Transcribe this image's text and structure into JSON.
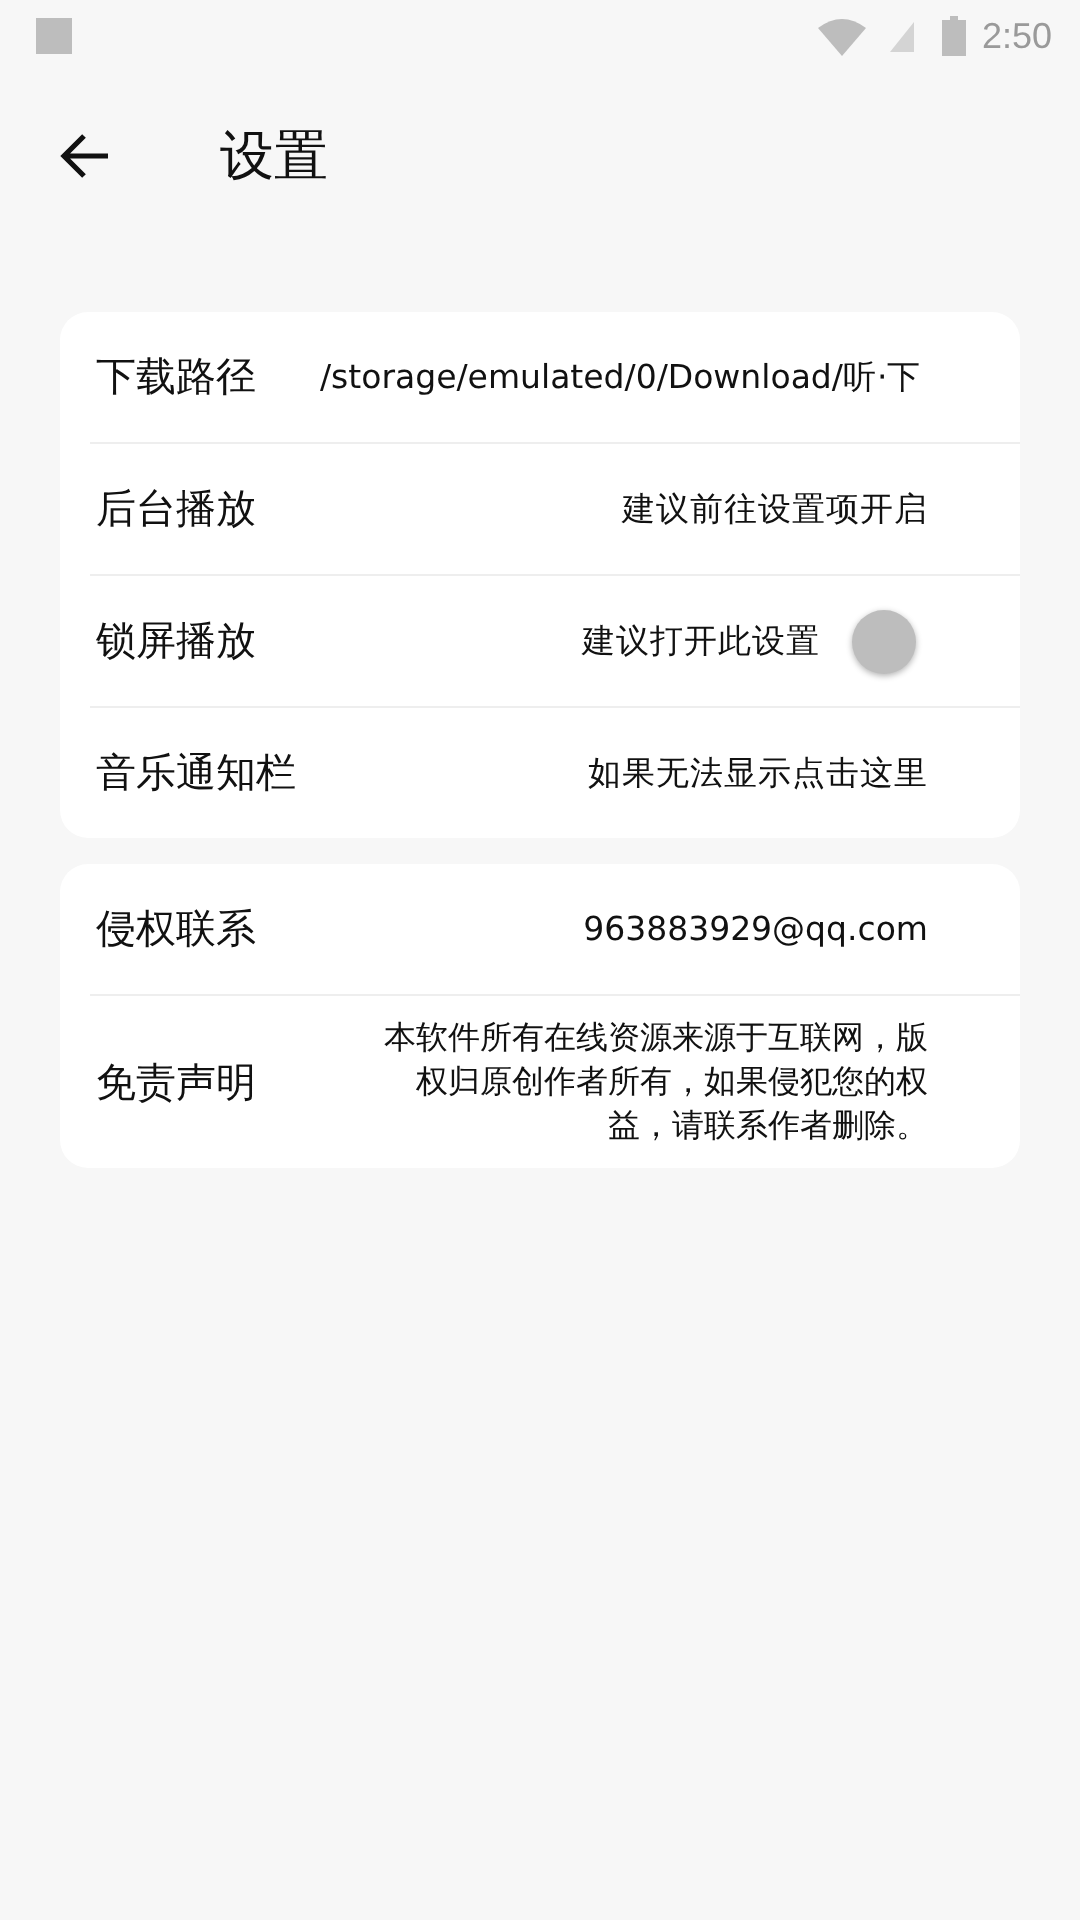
{
  "status_bar": {
    "time": "2:50"
  },
  "header": {
    "title": "设置"
  },
  "groups": [
    {
      "rows": [
        {
          "kind": "path",
          "label": "下载路径",
          "value": "/storage/emulated/0/Download/听·下"
        },
        {
          "kind": "text",
          "label": "后台播放",
          "value": "建议前往设置项开启"
        },
        {
          "kind": "toggle",
          "label": "锁屏播放",
          "value": "建议打开此设置",
          "on": false
        },
        {
          "kind": "text",
          "label": "音乐通知栏",
          "value": "如果无法显示点击这里"
        }
      ]
    },
    {
      "rows": [
        {
          "kind": "text",
          "label": "侵权联系",
          "value": "963883929@qq.com"
        },
        {
          "kind": "paragraph",
          "label": "免责声明",
          "value": "本软件所有在线资源来源于互联网，版权归原创作者所有，如果侵犯您的权益，请联系作者删除。"
        }
      ]
    }
  ]
}
